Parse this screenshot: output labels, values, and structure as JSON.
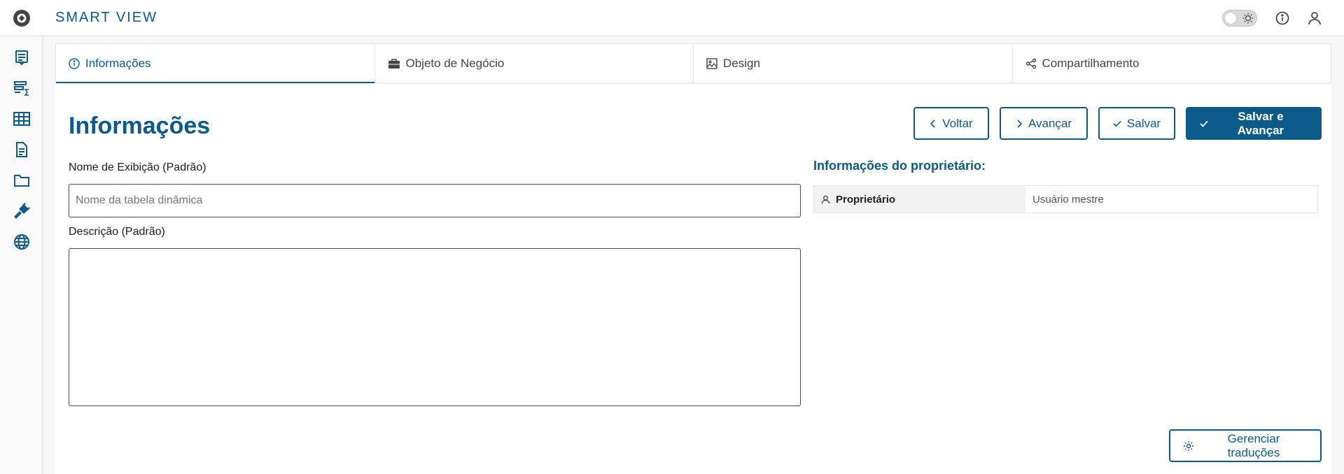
{
  "app": {
    "title": "SMART VIEW"
  },
  "sidebar": {
    "items": [
      {
        "icon": "report-icon"
      },
      {
        "icon": "summary-icon"
      },
      {
        "icon": "table-icon"
      },
      {
        "icon": "document-icon"
      },
      {
        "icon": "folder-icon"
      },
      {
        "icon": "plug-icon"
      },
      {
        "icon": "globe-icon"
      }
    ]
  },
  "tabs": [
    {
      "label": "Informações",
      "icon": "info-icon",
      "active": true
    },
    {
      "label": "Objeto de Negócio",
      "icon": "briefcase-icon"
    },
    {
      "label": "Design",
      "icon": "image-icon"
    },
    {
      "label": "Compartilhamento",
      "icon": "share-icon"
    }
  ],
  "page": {
    "title": "Informações",
    "buttons": {
      "back": "Voltar",
      "next": "Avançar",
      "save": "Salvar",
      "save_next": "Salvar e Avançar"
    },
    "display_name_label": "Nome de Exibição (Padrão)",
    "display_name_placeholder": "Nome da tabela dinâmica",
    "description_label": "Descrição (Padrão)",
    "owner_section_title": "Informações do proprietário:",
    "owner": {
      "key": "Proprietário",
      "value": "Usuário mestre"
    },
    "manage_translations": "Gerenciar traduções"
  },
  "colors": {
    "accent": "#0c5a8a"
  }
}
